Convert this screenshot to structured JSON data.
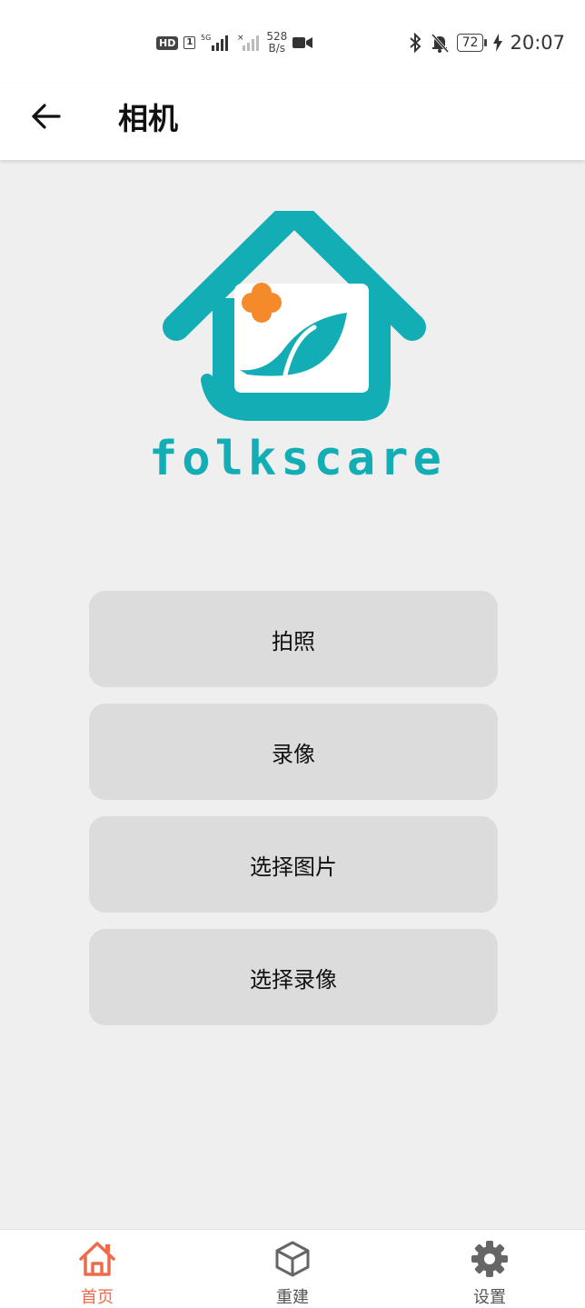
{
  "status_bar": {
    "network_speed_value": "528",
    "network_speed_unit": "B/s",
    "hd_label": "HD",
    "sim_label": "1",
    "battery_level": "72",
    "time": "20:07"
  },
  "app_bar": {
    "title": "相机"
  },
  "logo": {
    "brand_text": "folkscare",
    "primary_color": "#13aeb5",
    "accent_color": "#f58a2a"
  },
  "actions": [
    {
      "label": "拍照"
    },
    {
      "label": "录像"
    },
    {
      "label": "选择图片"
    },
    {
      "label": "选择录像"
    }
  ],
  "bottom_nav": {
    "items": [
      {
        "label": "首页",
        "icon": "home-icon",
        "active": true
      },
      {
        "label": "重建",
        "icon": "cube-icon",
        "active": false
      },
      {
        "label": "设置",
        "icon": "gear-icon",
        "active": false
      }
    ],
    "active_color": "#ee6a4a"
  }
}
